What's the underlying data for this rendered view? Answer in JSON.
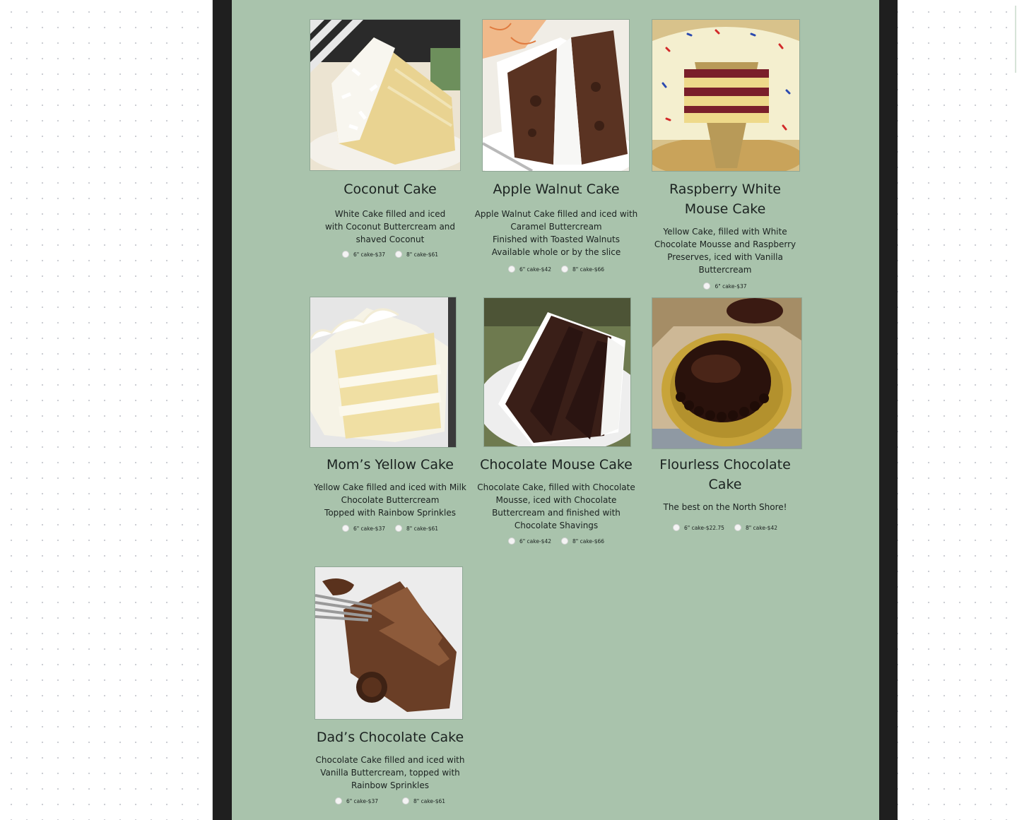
{
  "cakes": [
    {
      "name": "Coconut Cake",
      "description": [
        "White Cake filled and iced",
        "with Coconut Buttercream and",
        "shaved Coconut"
      ],
      "options": [
        "6\" cake-$37",
        "8\" cake-$61"
      ]
    },
    {
      "name": "Apple Walnut Cake",
      "description": [
        "Apple Walnut Cake filled and iced with",
        "Caramel Buttercream",
        "Finished with Toasted Walnuts",
        "Available whole or by the slice"
      ],
      "options": [
        "6\" cake-$42",
        "8\" cake-$66"
      ]
    },
    {
      "name": [
        "Raspberry White",
        "Mouse Cake"
      ],
      "description": [
        "Yellow Cake, filled with White",
        "Chocolate Mousse and Raspberry",
        "Preserves, iced with Vanilla",
        "Buttercream"
      ],
      "options": [
        "6\" cake-$37"
      ]
    },
    {
      "name": "Mom’s Yellow Cake",
      "description": [
        "Yellow Cake filled and iced with Milk",
        "Chocolate Buttercream",
        "Topped with Rainbow Sprinkles"
      ],
      "options": [
        "6\" cake-$37",
        "8\" cake-$61"
      ]
    },
    {
      "name": "Chocolate Mouse Cake",
      "description": [
        "Chocolate Cake, filled with Chocolate",
        "Mousse, iced with Chocolate",
        "Buttercream and finished with",
        "Chocolate Shavings"
      ],
      "options": [
        "6\" cake-$42",
        "8\" cake-$66"
      ]
    },
    {
      "name": [
        "Flourless Chocolate",
        "Cake"
      ],
      "description": [
        "The best on the North Shore!"
      ],
      "options": [
        "6\" cake-$22.75",
        "8\" cake-$42"
      ]
    },
    {
      "name": "Dad’s Chocolate Cake",
      "description": [
        "Chocolate Cake filled and iced with",
        "Vanilla Buttercream, topped with",
        "Rainbow Sprinkles"
      ],
      "options": [
        "6\" cake-$37",
        "8\" cake-$61"
      ]
    }
  ]
}
